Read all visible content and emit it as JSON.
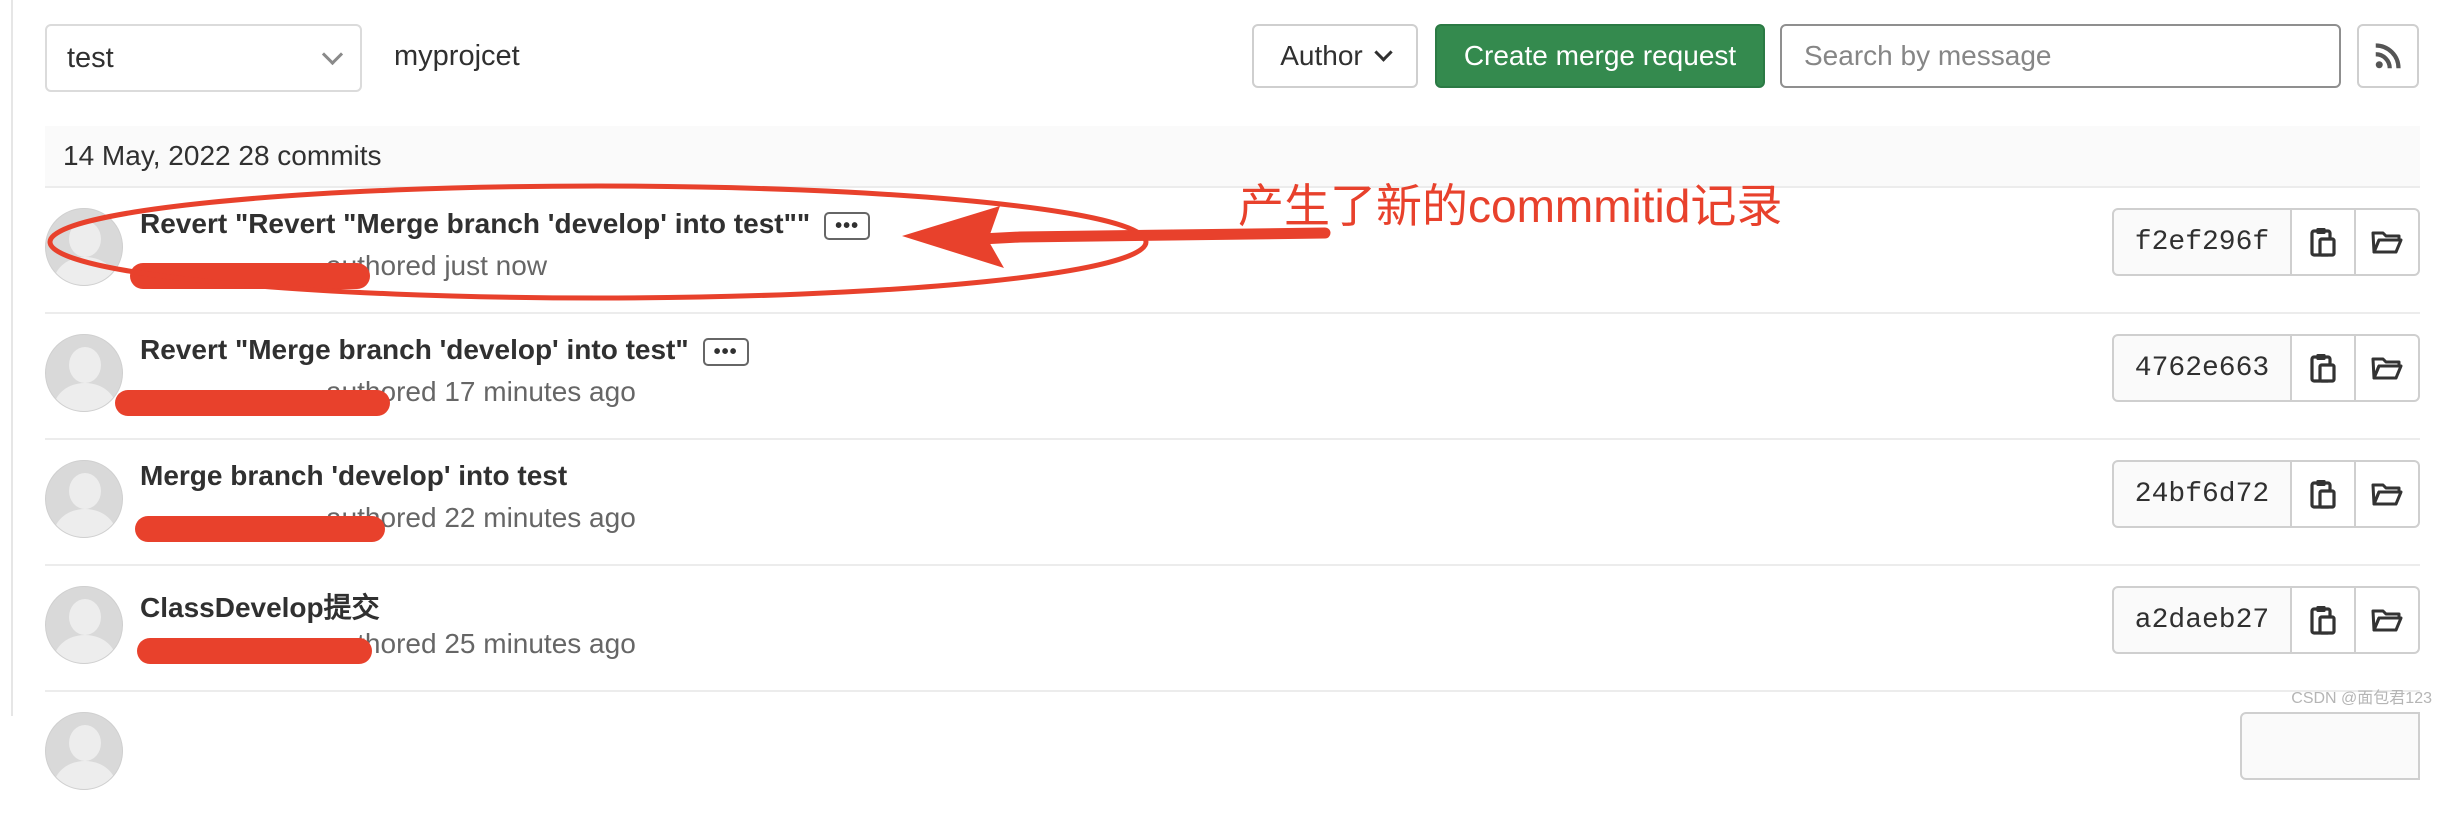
{
  "toolbar": {
    "branch_value": "test",
    "project_name": "myprojcet",
    "author_label": "Author",
    "create_mr_label": "Create merge request",
    "search_placeholder": "Search by message",
    "rss_icon": "rss-icon"
  },
  "day_header": "14 May, 2022 28 commits",
  "commits": [
    {
      "title": "Revert \"Revert \"Merge branch 'develop' into test\"\"",
      "has_ellipsis": true,
      "meta": "authored just now",
      "sha": "f2ef296f"
    },
    {
      "title": "Revert \"Merge branch 'develop' into test\"",
      "has_ellipsis": true,
      "meta": "authored 17 minutes ago",
      "sha": "4762e663"
    },
    {
      "title": "Merge branch 'develop' into test",
      "has_ellipsis": false,
      "meta": "authored 22 minutes ago",
      "sha": "24bf6d72"
    },
    {
      "title": "ClassDevelop提交",
      "has_ellipsis": false,
      "meta": "authored 25 minutes ago",
      "sha": "a2daeb27"
    }
  ],
  "ellipsis_text": "•••",
  "annotation": {
    "text": "产生了新的commmitid记录",
    "color": "#e8412c"
  },
  "watermark": "CSDN @面包君123",
  "colors": {
    "primary_green": "#348a4e",
    "annotation_red": "#e8412c"
  }
}
